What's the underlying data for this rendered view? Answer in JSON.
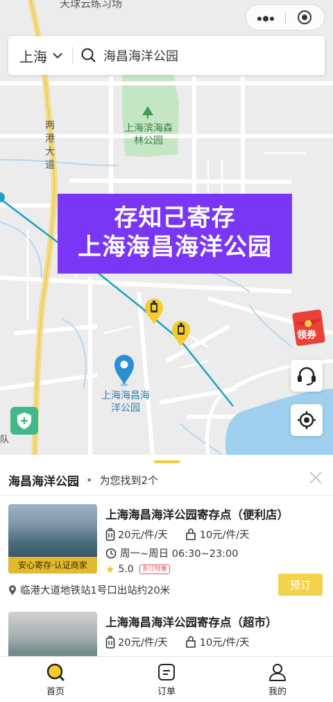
{
  "map": {
    "top_partial_label": "天球云练习场",
    "road_label": "两港大道",
    "park_label": "上海滨海森林公园",
    "poi_label": "上海海昌海洋公园",
    "left_edge_label": "队"
  },
  "capsule": {
    "more_icon": "more-dots-icon",
    "close_icon": "target-close-icon"
  },
  "search": {
    "city": "上海",
    "query": "海昌海洋公园"
  },
  "banner": {
    "line1": "存知己寄存",
    "line2": "上海海昌海洋公园"
  },
  "coupon": {
    "label": "领券"
  },
  "sheet": {
    "title": "海昌海洋公园",
    "dot": "•",
    "result_text": "为您找到2个",
    "stores": [
      {
        "name": "上海海昌海洋公园寄存点（便利店）",
        "price_large": "20元/件/天",
        "price_small": "10元/件/天",
        "badge": "安心寄存·认证商家",
        "hours": "周一~周日 06:30~23:00",
        "rating": "5.0",
        "rating_value": 5.0,
        "tag": "多订特惠",
        "location": "临港大道地铁站1号口出站约20米",
        "book_label": "预订"
      },
      {
        "name": "上海海昌海洋公园寄存点（超市）",
        "price_large": "20元/件/天",
        "price_small": "10元/件/天"
      }
    ]
  },
  "tabs": [
    {
      "label": "首页",
      "icon": "search-home-icon",
      "active": true
    },
    {
      "label": "订单",
      "icon": "order-icon",
      "active": false
    },
    {
      "label": "我的",
      "icon": "profile-icon",
      "active": false
    }
  ],
  "colors": {
    "accent": "#f4d34c",
    "banner": "#7a36f5",
    "pin": "#2b8fd3"
  }
}
